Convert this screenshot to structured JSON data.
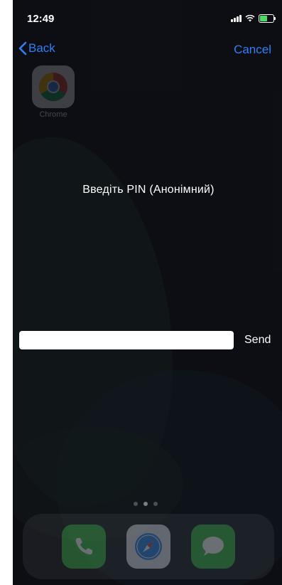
{
  "status_bar": {
    "time": "12:49",
    "battery_level": 0.6
  },
  "nav": {
    "back_label": "Back",
    "cancel_label": "Cancel"
  },
  "home_screen": {
    "app_label": "Chrome"
  },
  "prompt": {
    "title": "Введіть  PIN  (Анонімний)"
  },
  "pin_field": {
    "value": "",
    "placeholder": ""
  },
  "send": {
    "label": "Send"
  },
  "colors": {
    "accent": "#2f7ff5",
    "background": "#0f1116",
    "battery": "#4cd964"
  },
  "dock": {
    "icons": [
      "phone-icon",
      "safari-icon",
      "messages-icon"
    ]
  }
}
